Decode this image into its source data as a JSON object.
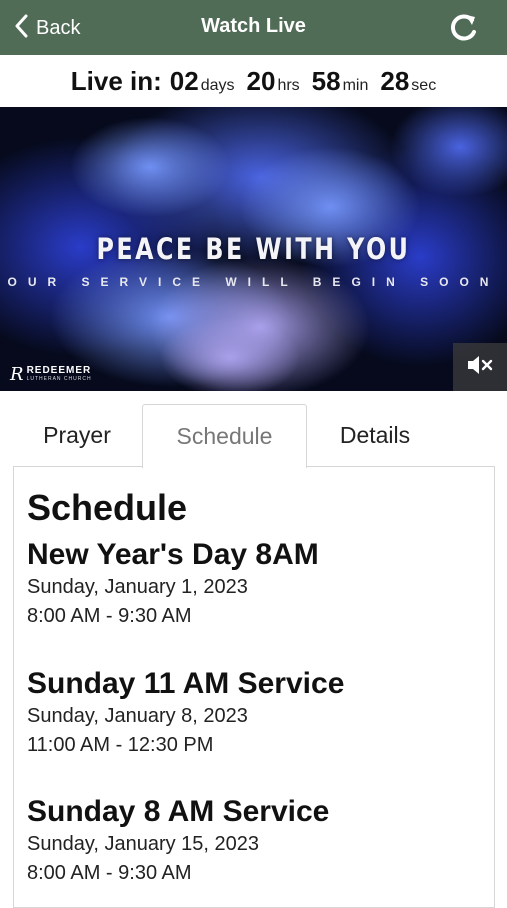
{
  "navbar": {
    "back_label": "Back",
    "title": "Watch Live",
    "bg_color": "#506c56",
    "refresh_icon": "refresh-icon"
  },
  "countdown": {
    "prefix": "Live in:",
    "days": "02",
    "days_unit": "days",
    "hours": "20",
    "hours_unit": "hrs",
    "minutes": "58",
    "minutes_unit": "min",
    "seconds": "28",
    "seconds_unit": "sec"
  },
  "video": {
    "headline": "PEACE BE WITH YOU",
    "subline": "OUR SERVICE WILL BEGIN SOON",
    "logo_mark": "R",
    "logo_name": "REDEEMER",
    "logo_sub": "LUTHERAN CHURCH",
    "mute_icon": "mute-icon"
  },
  "tabs": [
    {
      "label": "Prayer",
      "active": false
    },
    {
      "label": "Schedule",
      "active": true
    },
    {
      "label": "Details",
      "active": false
    }
  ],
  "schedule": {
    "heading": "Schedule",
    "events": [
      {
        "title": "New Year's Day 8AM",
        "date": "Sunday, January 1, 2023",
        "time": "8:00 AM - 9:30 AM"
      },
      {
        "title": "Sunday 11 AM Service",
        "date": "Sunday, January 8, 2023",
        "time": "11:00 AM - 12:30 PM"
      },
      {
        "title": "Sunday 8 AM Service",
        "date": "Sunday, January 15, 2023",
        "time": "8:00 AM - 9:30 AM"
      }
    ]
  }
}
